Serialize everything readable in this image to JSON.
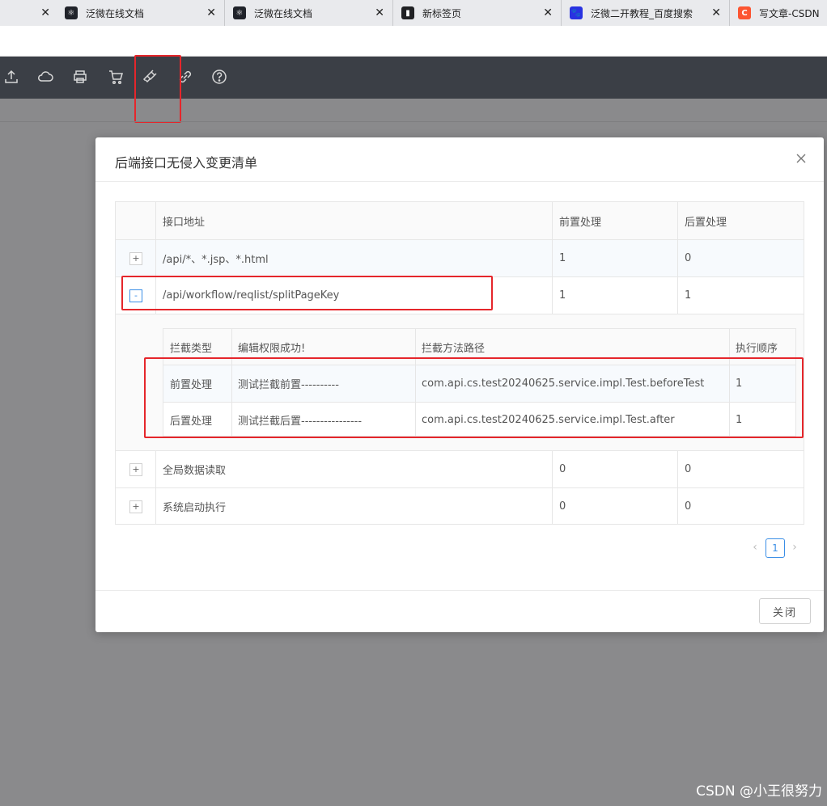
{
  "browser": {
    "tabs": [
      {
        "title": "泛微在线文档",
        "icon": "react-atom-icon",
        "color": "#20232a"
      },
      {
        "title": "泛微在线文档",
        "icon": "react-atom-icon",
        "color": "#20232a"
      },
      {
        "title": "新标签页",
        "icon": "new-tab-icon",
        "color": "#202124"
      },
      {
        "title": "泛微二开教程_百度搜索",
        "icon": "baidu-paw-icon",
        "color": "#2932e1"
      },
      {
        "title": "写文章-CSDN博客",
        "icon": "csdn-c-icon",
        "color": "#fc5531"
      }
    ]
  },
  "toolbar": {
    "icons": [
      "upload-icon",
      "cloud-icon",
      "printer-icon",
      "cart-icon",
      "plug-icon",
      "link-icon",
      "help-icon"
    ],
    "highlighted": "plug-icon"
  },
  "modal": {
    "title": "后端接口无侵入变更清单",
    "columns": [
      "接口地址",
      "前置处理",
      "后置处理"
    ],
    "rows": [
      {
        "expand": "+",
        "path": "/api/*、*.jsp、*.html",
        "pre": "1",
        "post": "0"
      },
      {
        "expand": "-",
        "path": "/api/workflow/reqlist/splitPageKey",
        "pre": "1",
        "post": "1"
      },
      {
        "expand": "+",
        "path": "全局数据读取",
        "pre": "0",
        "post": "0"
      },
      {
        "expand": "+",
        "path": "系统启动执行",
        "pre": "0",
        "post": "0"
      }
    ],
    "subtable": {
      "columns": [
        "拦截类型",
        "编辑权限成功!",
        "拦截方法路径",
        "执行顺序"
      ],
      "rows": [
        {
          "type": "前置处理",
          "desc": "测试拦截前置----------",
          "method": "com.api.cs.test20240625.service.impl.Test.beforeTest",
          "order": "1"
        },
        {
          "type": "后置处理",
          "desc": "测试拦截后置----------------",
          "method": "com.api.cs.test20240625.service.impl.Test.after",
          "order": "1"
        }
      ]
    },
    "pager": {
      "prev": "‹",
      "current": "1",
      "next": "›"
    },
    "close_label": "关闭"
  },
  "watermark": "CSDN @小王很努力"
}
